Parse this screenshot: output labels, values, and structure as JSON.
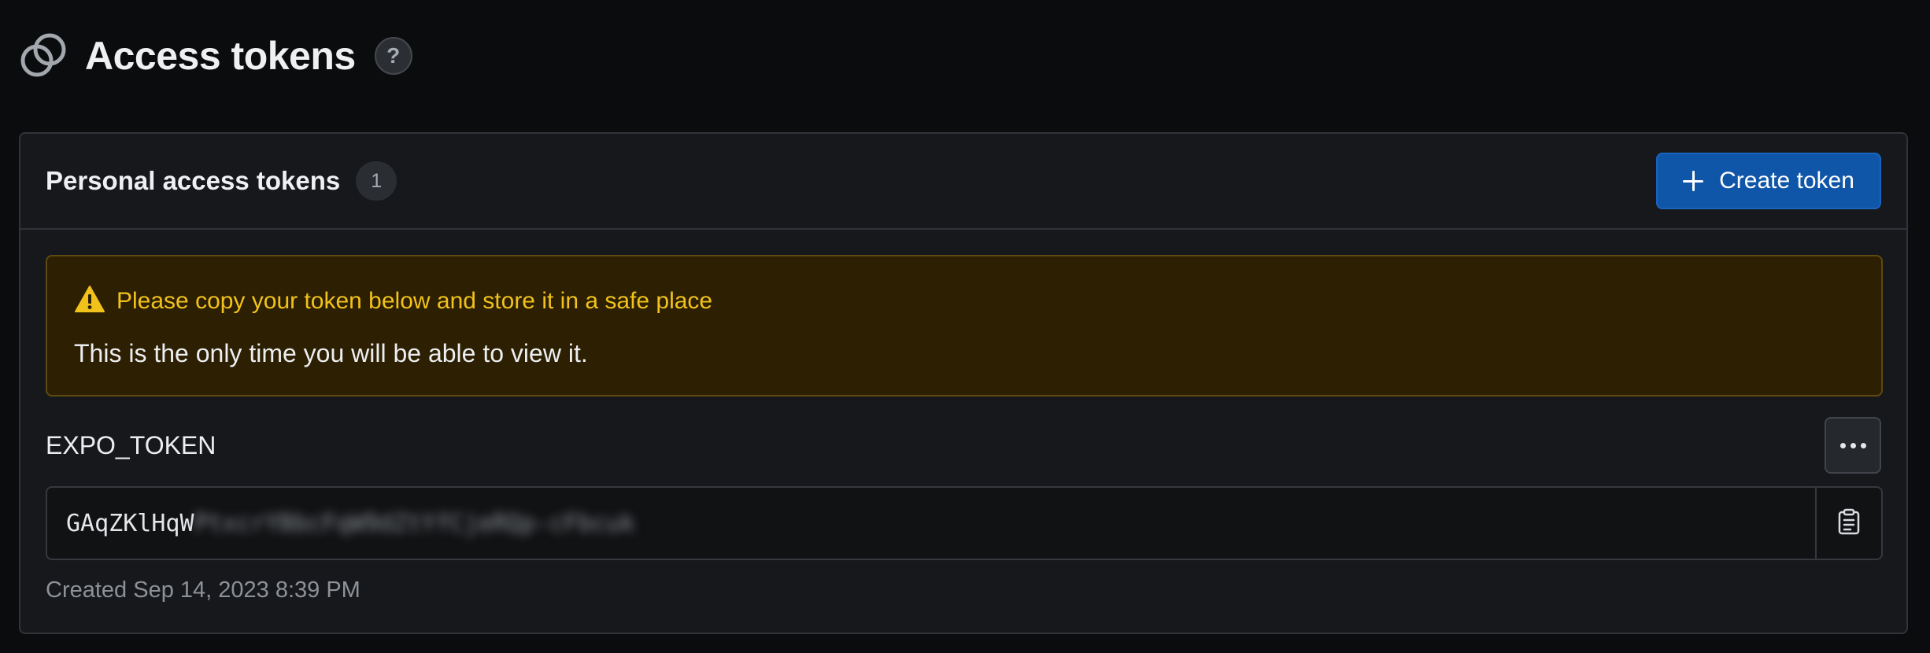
{
  "page": {
    "title": "Access tokens",
    "help_icon": "question-icon",
    "help_label": "?"
  },
  "panel": {
    "title": "Personal access tokens",
    "count": "1",
    "create_button_label": "Create token"
  },
  "warning": {
    "title": "Please copy your token below and store it in a safe place",
    "message": "This is the only time you will be able to view it."
  },
  "token": {
    "name": "EXPO_TOKEN",
    "visible_prefix": "GAqZKlHqW",
    "redacted_part": "PtxcrYBbcFqW9dZtYfCjeRQp-cFbcuk",
    "created": "Created Sep 14, 2023 8:39 PM"
  },
  "colors": {
    "background": "#0b0c0e",
    "panel": "#17181b",
    "accent": "#0f55a8",
    "warning_bg": "#2c1f02",
    "warning_text": "#f1c21b"
  }
}
